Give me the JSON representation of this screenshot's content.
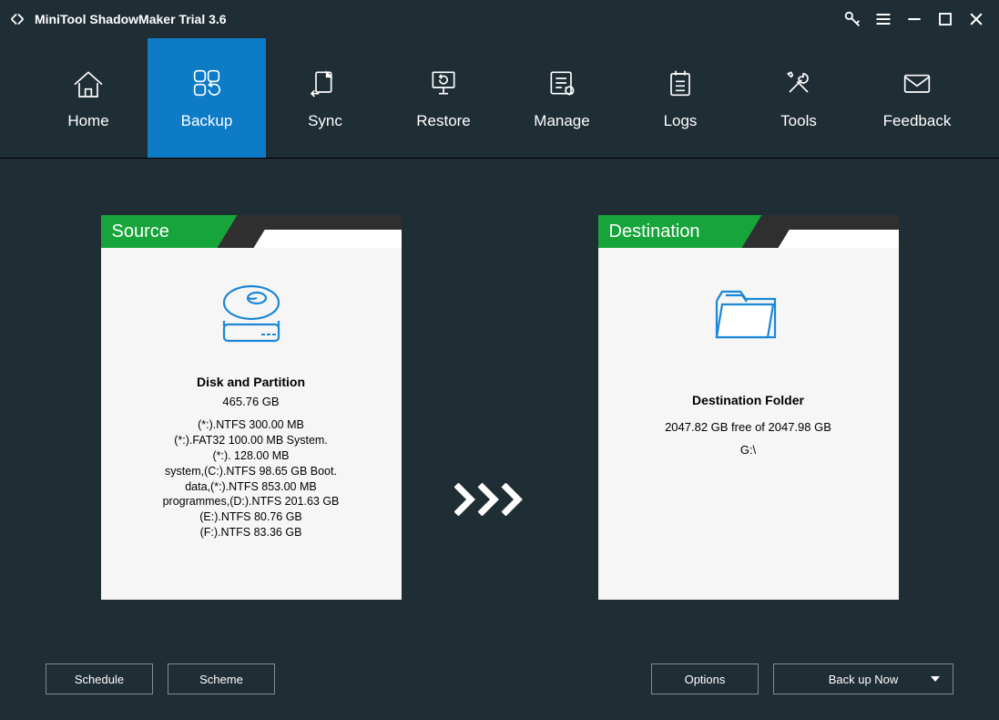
{
  "app": {
    "title": "MiniTool ShadowMaker Trial 3.6"
  },
  "tabs": [
    {
      "label": "Home"
    },
    {
      "label": "Backup"
    },
    {
      "label": "Sync"
    },
    {
      "label": "Restore"
    },
    {
      "label": "Manage"
    },
    {
      "label": "Logs"
    },
    {
      "label": "Tools"
    },
    {
      "label": "Feedback"
    }
  ],
  "source": {
    "ribbon": "Source",
    "title": "Disk and Partition",
    "size": "465.76 GB",
    "lines": [
      "(*:).NTFS 300.00 MB",
      "(*:).FAT32 100.00 MB System.",
      "(*:). 128.00 MB",
      "system,(C:).NTFS 98.65 GB Boot.",
      "data,(*:).NTFS 853.00 MB",
      "programmes,(D:).NTFS 201.63 GB",
      "(E:).NTFS 80.76 GB",
      "(F:).NTFS 83.36 GB"
    ]
  },
  "destination": {
    "ribbon": "Destination",
    "title": "Destination Folder",
    "free": "2047.82 GB free of 2047.98 GB",
    "path": "G:\\"
  },
  "footer": {
    "schedule": "Schedule",
    "scheme": "Scheme",
    "options": "Options",
    "backup": "Back up Now"
  }
}
